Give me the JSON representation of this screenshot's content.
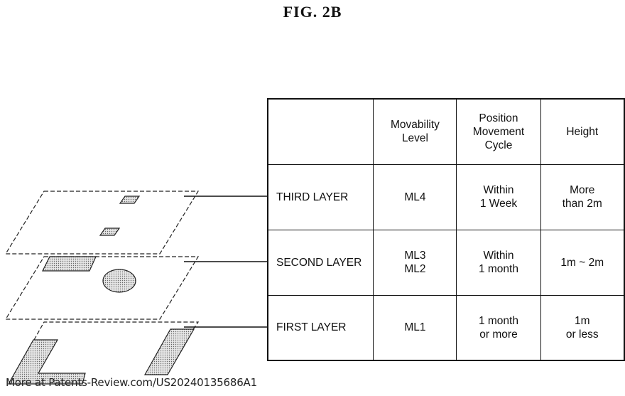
{
  "figure": {
    "title": "FIG. 2B"
  },
  "table": {
    "headers": [
      "",
      "Movability\nLevel",
      "Position\nMovement\nCycle",
      "Height"
    ],
    "rows": [
      {
        "layer": "THIRD LAYER",
        "movability": "ML4",
        "cycle": "Within\n1 Week",
        "height": "More\nthan 2m"
      },
      {
        "layer": "SECOND LAYER",
        "movability": "ML3\nML2",
        "cycle": "Within\n1 month",
        "height": "1m ~ 2m"
      },
      {
        "layer": "FIRST LAYER",
        "movability": "ML1",
        "cycle": "1 month\nor more",
        "height": "1m\nor less"
      }
    ]
  },
  "diagram": {
    "layers": [
      {
        "name": "third-layer",
        "objects": [
          "small-box",
          "small-box"
        ]
      },
      {
        "name": "second-layer",
        "objects": [
          "rectangle",
          "ellipse"
        ]
      },
      {
        "name": "first-layer",
        "objects": [
          "l-shaped-wall",
          "bar"
        ]
      }
    ]
  },
  "watermark": "More at Patents-Review.com/US20240135686A1"
}
